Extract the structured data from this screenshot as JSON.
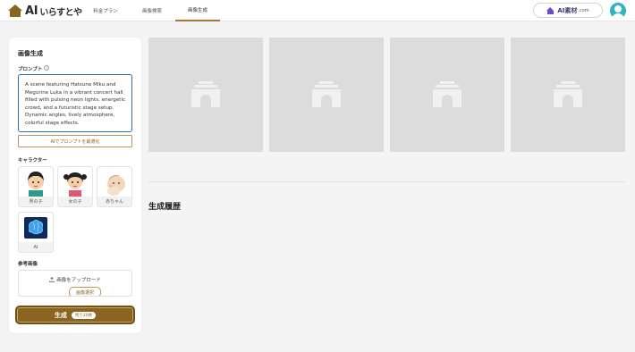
{
  "header": {
    "logo_ai": "AI",
    "logo_jp": "いらすとや",
    "nav": [
      "料金プラン",
      "画像検索",
      "画像生成"
    ],
    "active_nav": "画像生成",
    "ai_sozai_label": "AI素材",
    "ai_sozai_suffix": ".com"
  },
  "sidebar": {
    "title": "画像生成",
    "prompt_label": "プロンプト",
    "help_glyph": "?",
    "prompt_text": "A scene featuring Hatsune Miku and Megurine Luka in a vibrant concert hall filled with pulsing neon lights, energetic crowd, and a futuristic stage setup. Dynamic angles, lively atmosphere, colorful stage effects.",
    "optimize_label": "AIでプロンプトを最適化",
    "character_label": "キャラクター",
    "characters": [
      {
        "name": "男の子",
        "icon": "boy-icon"
      },
      {
        "name": "女の子",
        "icon": "girl-icon"
      },
      {
        "name": "赤ちゃん",
        "icon": "baby-icon"
      },
      {
        "name": "AI",
        "icon": "brain-icon"
      }
    ],
    "reference_label": "参考画像",
    "upload_label": "画像をアップロード",
    "select_label": "画像選択",
    "generate_label": "生成",
    "remaining_label": "残り20枚"
  },
  "main": {
    "history_title": "生成履歴",
    "placeholder_icon": "image-placeholder-icon"
  },
  "colors": {
    "accent": "#8a6520",
    "prompt_border": "#2a6fa8",
    "avatar": "#2fb5bd"
  }
}
